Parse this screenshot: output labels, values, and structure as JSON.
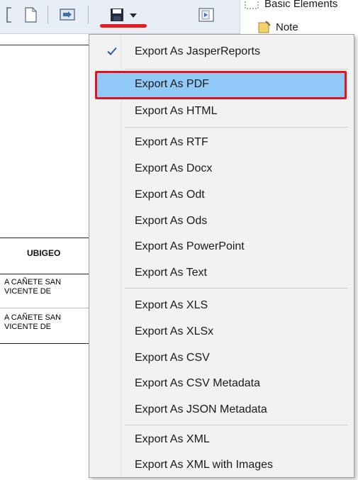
{
  "palette": {
    "basic_elements": "Basic Elements",
    "note": "Note"
  },
  "report": {
    "column_header": "UBIGEO",
    "rows": [
      {
        "line1": "A CAÑETE SAN",
        "line2": "VICENTE DE"
      },
      {
        "line1": "A CAÑETE SAN",
        "line2": "VICENTE DE"
      }
    ]
  },
  "colors": {
    "highlight": "#e3131b",
    "selection": "#91c9f7",
    "menu_background": "#f2f2f2"
  },
  "menu": {
    "items": [
      {
        "label": "Export As JasperReports",
        "checked": true,
        "icon": "checkmark-icon"
      },
      {
        "label": "Export As PDF",
        "selected": true
      },
      {
        "label": "Export As HTML"
      },
      {
        "label": "Export As RTF"
      },
      {
        "label": "Export As Docx"
      },
      {
        "label": "Export As Odt"
      },
      {
        "label": "Export As Ods"
      },
      {
        "label": "Export As PowerPoint"
      },
      {
        "label": "Export As Text"
      },
      {
        "label": "Export As XLS"
      },
      {
        "label": "Export As XLSx"
      },
      {
        "label": "Export As CSV"
      },
      {
        "label": "Export As CSV Metadata"
      },
      {
        "label": "Export As JSON Metadata"
      },
      {
        "label": "Export As XML"
      },
      {
        "label": "Export As XML with Images"
      }
    ]
  }
}
